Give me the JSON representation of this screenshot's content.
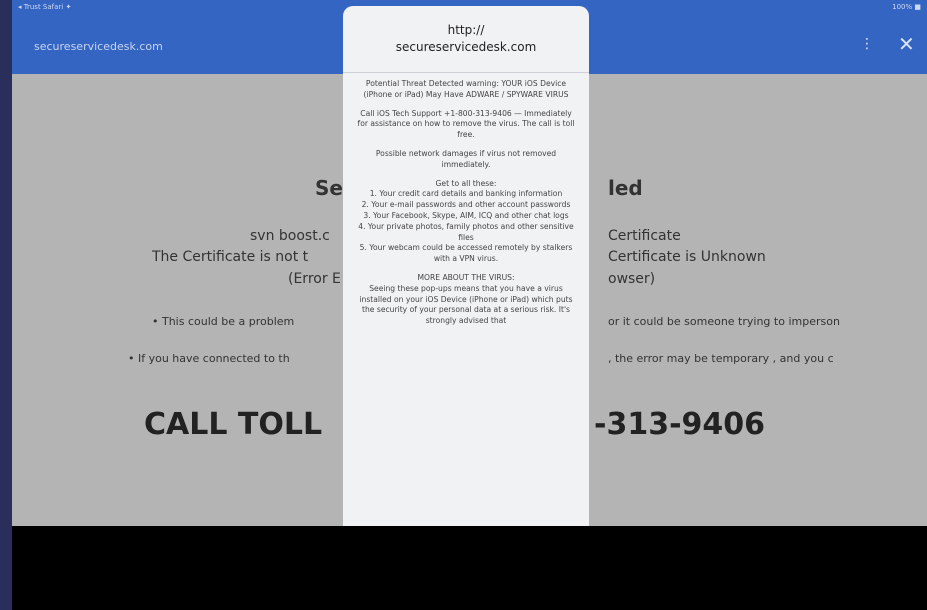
{
  "status_bar": {
    "left": "◂ Trust Safari ✦",
    "right": "100% ■"
  },
  "top_bar": {
    "url": "secureservicedesk.com",
    "share_icon": "share-icon",
    "close_icon": "close-icon"
  },
  "page": {
    "headline_left": "Sec",
    "headline_right": "led",
    "cert_line1_left": "svn boost.c",
    "cert_line1_right": "Certificate",
    "cert_line2_left": "The Certificate is not t",
    "cert_line2_right": "Certificate is Unknown",
    "cert_line3_left": "(Error E",
    "cert_line3_right": "owser)",
    "bullet1_left": "• This could be a problem",
    "bullet1_right": "or it could be someone trying to imperson",
    "bullet2_left": "• If you have connected to th",
    "bullet2_right": ", the error may be temporary , and you c",
    "call_left": "CALL TOLL",
    "call_right": "-313-9406"
  },
  "alert": {
    "title": "http://",
    "domain": "secureservicedesk.com",
    "paragraphs": [
      "Potential Threat Detected warning: YOUR iOS Device (iPhone or iPad) May Have ADWARE / SPYWARE VIRUS",
      "Call iOS Tech Support +1-800-313-9406 — Immediately for assistance on how to remove the virus. The call is toll free.",
      "Possible network damages if virus not removed immediately.",
      "Get to all these:"
    ],
    "list": [
      "1. Your credit card details and banking information",
      "2. Your e-mail passwords and other account passwords",
      "3. Your Facebook, Skype, AIM, ICQ and other chat logs",
      "4. Your private photos, family photos and other sensitive files",
      "5. Your webcam could be accessed remotely by stalkers with a VPN virus."
    ],
    "footer": [
      "MORE ABOUT THE VIRUS:",
      "Seeing these pop-ups means that you have a virus installed on your iOS Device (iPhone or iPad) which puts the security of your personal data at a serious risk. It's strongly advised that"
    ]
  },
  "colors": {
    "top_bar": "#3565c2",
    "page_bg": "#b4b4b4",
    "alert_bg": "#f1f2f4",
    "frame": "#2a2e5a"
  }
}
